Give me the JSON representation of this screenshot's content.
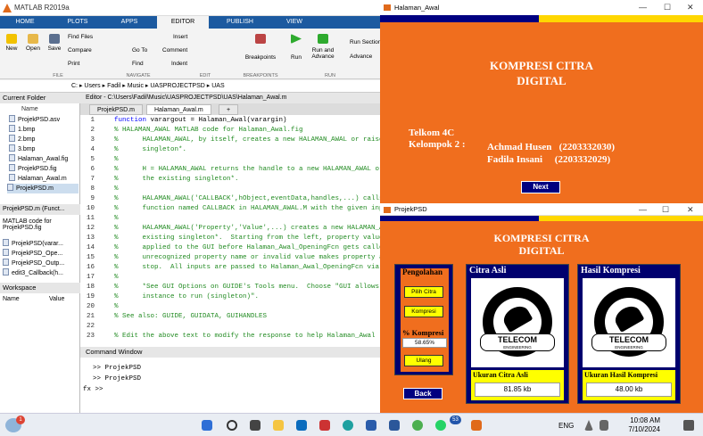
{
  "matlab": {
    "title": "MATLAB R2019a",
    "tabs": [
      "HOME",
      "PLOTS",
      "APPS",
      "EDITOR",
      "PUBLISH",
      "VIEW"
    ],
    "ribbon": {
      "new": "New",
      "open": "Open",
      "save": "Save",
      "find_files": "Find Files",
      "compare": "Compare",
      "print": "Print",
      "go_to": "Go To",
      "find": "Find",
      "insert": "Insert",
      "comment": "Comment",
      "indent": "Indent",
      "breakpoints": "Breakpoints",
      "run": "Run",
      "run_and_advance": "Run and Advance",
      "run_section": "Run Section",
      "advance": "Advance",
      "sec_file": "FILE",
      "sec_navigate": "NAVIGATE",
      "sec_edit": "EDIT",
      "sec_breakpoints": "BREAKPOINTS",
      "sec_run": "RUN"
    },
    "path": [
      "C:",
      "Users",
      "Fadil",
      "Music",
      "UASPROJECTPSD",
      "UAS"
    ],
    "current_folder": {
      "title": "Current Folder",
      "col_name": "Name",
      "files": [
        "ProjekPSD.asv",
        "1.bmp",
        "2.bmp",
        "3.bmp",
        "Halaman_Awal.fig",
        "ProjekPSD.fig",
        "Halaman_Awal.m",
        "ProjekPSD.m"
      ]
    },
    "details": {
      "title": "ProjekPSD.m  (Funct...",
      "desc": "MATLAB code for ProjekPSD.fig",
      "items": [
        "ProjekPSD(varar...",
        "ProjekPSD_Ope...",
        "ProjekPSD_Outp...",
        "edit3_Callback(h..."
      ]
    },
    "workspace": {
      "title": "Workspace",
      "col_name": "Name",
      "col_value": "Value"
    },
    "editor": {
      "title": "Editor - C:\\Users\\Fadil\\Music\\UASPROJECTPSD\\UAS\\Halaman_Awal.m",
      "tabs": [
        "ProjekPSD.m",
        "Halaman_Awal.m",
        "+"
      ],
      "lines": [
        {
          "n": "1",
          "t": "function varargout = Halaman_Awal(varargin)",
          "kw": true
        },
        {
          "n": "2",
          "t": "% HALAMAN_AWAL MATLAB code for Halaman_Awal.fig"
        },
        {
          "n": "3",
          "t": "%      HALAMAN_AWAL, by itself, creates a new HALAMAN_AWAL or raises the"
        },
        {
          "n": "4",
          "t": "%      singleton*."
        },
        {
          "n": "5",
          "t": "%"
        },
        {
          "n": "6",
          "t": "%      H = HALAMAN_AWAL returns the handle to a new HALAMAN_AWAL or the handle to"
        },
        {
          "n": "7",
          "t": "%      the existing singleton*."
        },
        {
          "n": "8",
          "t": "%"
        },
        {
          "n": "9",
          "t": "%      HALAMAN_AWAL('CALLBACK',hObject,eventData,handles,...) calls the local"
        },
        {
          "n": "10",
          "t": "%      function named CALLBACK in HALAMAN_AWAL.M with the given input arguments."
        },
        {
          "n": "11",
          "t": "%"
        },
        {
          "n": "12",
          "t": "%      HALAMAN_AWAL('Property','Value',...) creates a new HALAMAN_AWAL or raises the"
        },
        {
          "n": "13",
          "t": "%      existing singleton*.  Starting from the left, property value pairs are"
        },
        {
          "n": "14",
          "t": "%      applied to the GUI before Halaman_Awal_OpeningFcn gets called.  An"
        },
        {
          "n": "15",
          "t": "%      unrecognized property name or invalid value makes property application"
        },
        {
          "n": "16",
          "t": "%      stop.  All inputs are passed to Halaman_Awal_OpeningFcn via varargin."
        },
        {
          "n": "17",
          "t": "%"
        },
        {
          "n": "18",
          "t": "%      *See GUI Options on GUIDE's Tools menu.  Choose \"GUI allows only one"
        },
        {
          "n": "19",
          "t": "%      instance to run (singleton)\"."
        },
        {
          "n": "20",
          "t": "%"
        },
        {
          "n": "21",
          "t": "% See also: GUIDE, GUIDATA, GUIHANDLES"
        },
        {
          "n": "22",
          "t": ""
        },
        {
          "n": "23",
          "t": "% Edit the above text to modify the response to help Halaman_Awal"
        }
      ]
    },
    "command_window": {
      "title": "Command Window",
      "lines": [
        ">> ProjekPSD",
        ">> ProjekPSD"
      ],
      "prompt": "fx >>"
    }
  },
  "halaman_awal": {
    "title": "Halaman_Awal",
    "heading1": "KOMPRESI CITRA",
    "heading2": "DIGITAL",
    "group": "Telkom 4C",
    "kelompok": "Kelompok 2 :",
    "member1": "Achmad Husen   (2203332030)",
    "member2": "Fadila Insani     (2203332029)",
    "next": "Next",
    "colors": {
      "bg": "#f06e1e",
      "navy": "#000080",
      "yellow": "#ffd700"
    }
  },
  "projekpsd": {
    "title": "ProjekPSD",
    "heading1": "KOMPRESI CITRA",
    "heading2": "DIGITAL",
    "pengolahan": "Pengolahan",
    "pilih": "Pilih Citra",
    "kompresi_btn": "Kompresi",
    "persen_label": "% Kompresi",
    "persen_value": "58.65%",
    "ulang": "Ulang",
    "back": "Back",
    "citra_asli": "Citra Asli",
    "hasil_kompresi": "Hasil Kompresi",
    "ukuran_asli_label": "Ukuran Citra Asli",
    "ukuran_asli": "81.85 kb",
    "ukuran_hasil_label": "Ukuran Hasil Kompresi",
    "ukuran_hasil": "48.00 kb",
    "logo_text": "TELECOM",
    "logo_sub": "ENGINEERING"
  },
  "taskbar": {
    "lang": "ENG",
    "time": "10:08 AM",
    "date": "7/10/2024",
    "badge": "53",
    "notif": "1"
  }
}
